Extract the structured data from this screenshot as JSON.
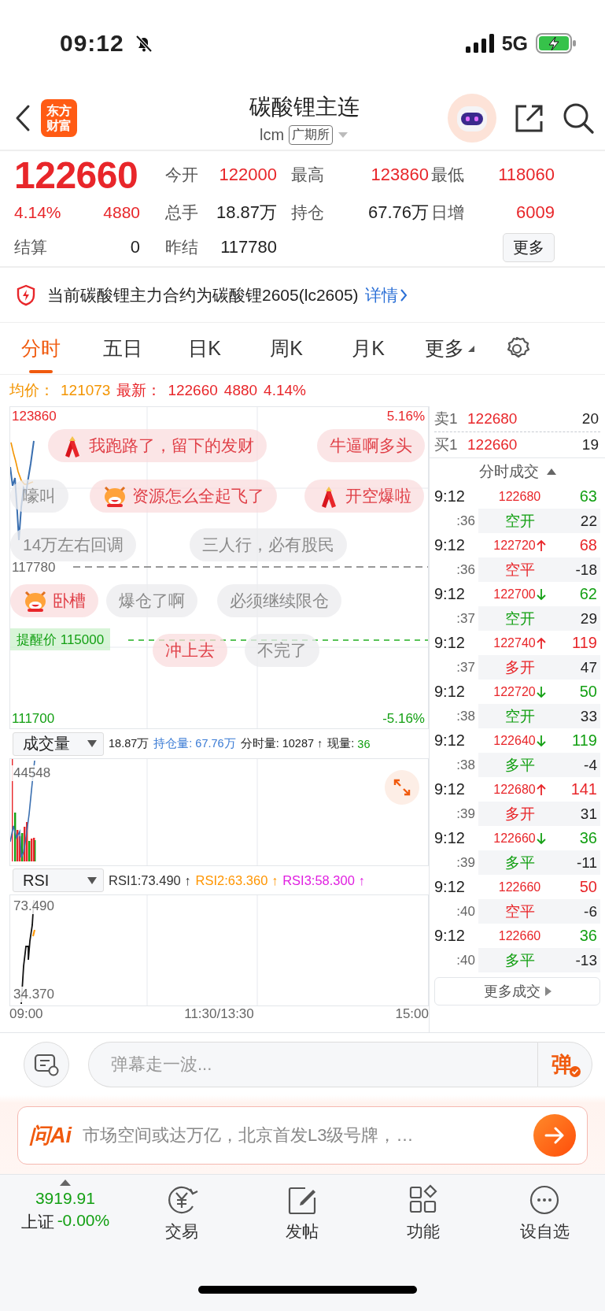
{
  "status_bar": {
    "time": "09:12",
    "network": "5G"
  },
  "header": {
    "logo_lines": [
      "东方",
      "财富"
    ],
    "title": "碳酸锂主连",
    "code": "lcm",
    "exchange": "广期所"
  },
  "quote": {
    "price": "122660",
    "change_pct": "4.14%",
    "change": "4880",
    "settle_label": "结算",
    "settle": "0",
    "fields": [
      {
        "label": "今开",
        "value": "122000",
        "color": "#e8262a"
      },
      {
        "label": "最高",
        "value": "123860",
        "color": "#e8262a"
      },
      {
        "label": "最低",
        "value": "118060",
        "color": "#e8262a"
      },
      {
        "label": "总手",
        "value": "18.87万",
        "color": "#222222"
      },
      {
        "label": "持仓",
        "value": "67.76万",
        "color": "#222222"
      },
      {
        "label": "日增",
        "value": "6009",
        "color": "#e8262a"
      },
      {
        "label": "昨结",
        "value": "117780",
        "color": "#222222"
      }
    ],
    "more_button": "更多"
  },
  "notice": {
    "text": "当前碳酸锂主力合约为碳酸锂2605(lc2605)",
    "link": "详情"
  },
  "tabs": [
    {
      "label": "分时",
      "kind": "tab",
      "selected": true
    },
    {
      "label": "五日",
      "kind": "tab",
      "selected": false
    },
    {
      "label": "日K",
      "kind": "tab",
      "selected": false
    },
    {
      "label": "周K",
      "kind": "tab",
      "selected": false
    },
    {
      "label": "月K",
      "kind": "tab",
      "selected": false
    },
    {
      "label": "更多",
      "kind": "menu",
      "selected": false
    }
  ],
  "info_line": {
    "avg_label": "均价：",
    "avg": "121073",
    "last_label": "最新：",
    "last": "122660",
    "change": "4880",
    "change_pct": "4.14%"
  },
  "main_chart": {
    "high": "123860",
    "high_pct": "5.16%",
    "prev_close": "117780",
    "low": "111700",
    "low_pct": "-5.16%",
    "alert": "提醒价 115000"
  },
  "danmaku": [
    {
      "text": "我跑路了，留下的发财",
      "kind": "firecracker"
    },
    {
      "text": "牛逼啊多头",
      "kind": "pink"
    },
    {
      "text": "嚎叫",
      "kind": "grey"
    },
    {
      "text": "资源怎么全起飞了",
      "kind": "cow"
    },
    {
      "text": "开空爆啦",
      "kind": "firecracker"
    },
    {
      "text": "14万左右回调",
      "kind": "grey"
    },
    {
      "text": "三人行，必有股民",
      "kind": "grey"
    },
    {
      "text": "卧槽",
      "kind": "cow"
    },
    {
      "text": "爆仓了啊",
      "kind": "grey"
    },
    {
      "text": "必须继续限仓",
      "kind": "grey"
    },
    {
      "text": "冲上去",
      "kind": "pink"
    },
    {
      "text": "不完了",
      "kind": "grey"
    }
  ],
  "volume_panel": {
    "indicator": "成交量",
    "total": "18.87万",
    "open_interest": "持仓量: 67.76万",
    "minute_volume": "分时量: 10287 ↑",
    "current_label": "现量:",
    "current": "36",
    "axis_max": "44548"
  },
  "rsi_panel": {
    "indicator": "RSI",
    "values": [
      {
        "text": "RSI1:73.490 ↑",
        "color": "#333333"
      },
      {
        "text": "RSI2:63.360 ↑",
        "color": "#ff9500"
      },
      {
        "text": "RSI3:58.300 ↑",
        "color": "#e020e0"
      }
    ],
    "axis_max": "73.490",
    "axis_min": "34.370"
  },
  "time_axis": [
    "09:00",
    "11:30/13:30",
    "15:00"
  ],
  "order_book": [
    {
      "label": "卖1",
      "price": "122680",
      "volume": "20"
    },
    {
      "label": "买1",
      "price": "122660",
      "volume": "19"
    }
  ],
  "trades_title": "分时成交",
  "trades": [
    {
      "time": "9:12",
      "second": ":36",
      "price": "122680",
      "kind": "flat",
      "volume": {
        "text": "63",
        "color": "#14a014"
      },
      "type": {
        "text": "空开",
        "color": "#14a014"
      },
      "delta": "22"
    },
    {
      "time": "9:12",
      "second": ":36",
      "price": "122720",
      "kind": "up",
      "volume": {
        "text": "68",
        "color": "#e8262a"
      },
      "type": {
        "text": "空平",
        "color": "#e8262a"
      },
      "delta": "-18"
    },
    {
      "time": "9:12",
      "second": ":37",
      "price": "122700",
      "kind": "down",
      "volume": {
        "text": "62",
        "color": "#14a014"
      },
      "type": {
        "text": "空开",
        "color": "#14a014"
      },
      "delta": "29"
    },
    {
      "time": "9:12",
      "second": ":37",
      "price": "122740",
      "kind": "up",
      "volume": {
        "text": "119",
        "color": "#e8262a"
      },
      "type": {
        "text": "多开",
        "color": "#e8262a"
      },
      "delta": "47"
    },
    {
      "time": "9:12",
      "second": ":38",
      "price": "122720",
      "kind": "down",
      "volume": {
        "text": "50",
        "color": "#14a014"
      },
      "type": {
        "text": "空开",
        "color": "#14a014"
      },
      "delta": "33"
    },
    {
      "time": "9:12",
      "second": ":38",
      "price": "122640",
      "kind": "down",
      "volume": {
        "text": "119",
        "color": "#14a014"
      },
      "type": {
        "text": "多平",
        "color": "#14a014"
      },
      "delta": "-4"
    },
    {
      "time": "9:12",
      "second": ":39",
      "price": "122680",
      "kind": "up",
      "volume": {
        "text": "141",
        "color": "#e8262a"
      },
      "type": {
        "text": "多开",
        "color": "#e8262a"
      },
      "delta": "31"
    },
    {
      "time": "9:12",
      "second": ":39",
      "price": "122660",
      "kind": "down",
      "volume": {
        "text": "36",
        "color": "#14a014"
      },
      "type": {
        "text": "多平",
        "color": "#14a014"
      },
      "delta": "-11"
    },
    {
      "time": "9:12",
      "second": ":40",
      "price": "122660",
      "kind": "flat",
      "volume": {
        "text": "50",
        "color": "#e8262a"
      },
      "type": {
        "text": "空平",
        "color": "#e8262a"
      },
      "delta": "-6"
    },
    {
      "time": "9:12",
      "second": ":40",
      "price": "122660",
      "kind": "flat",
      "volume": {
        "text": "36",
        "color": "#14a014"
      },
      "type": {
        "text": "多平",
        "color": "#14a014"
      },
      "delta": "-13"
    }
  ],
  "more_trades": "更多成交",
  "comment_bar": {
    "placeholder": "弹幕走一波...",
    "send": "弹"
  },
  "ai_bar": {
    "logo": "问Ai",
    "text": "市场空间或达万亿，北京首发L3级号牌，…"
  },
  "bottom_nav": {
    "index_value": "3919.91",
    "index_name": "上证",
    "index_change": "-0.00%",
    "items": [
      {
        "label": "交易",
        "kind": "trade"
      },
      {
        "label": "发帖",
        "kind": "post"
      },
      {
        "label": "功能",
        "kind": "apps"
      },
      {
        "label": "设自选",
        "kind": "watch"
      }
    ]
  }
}
